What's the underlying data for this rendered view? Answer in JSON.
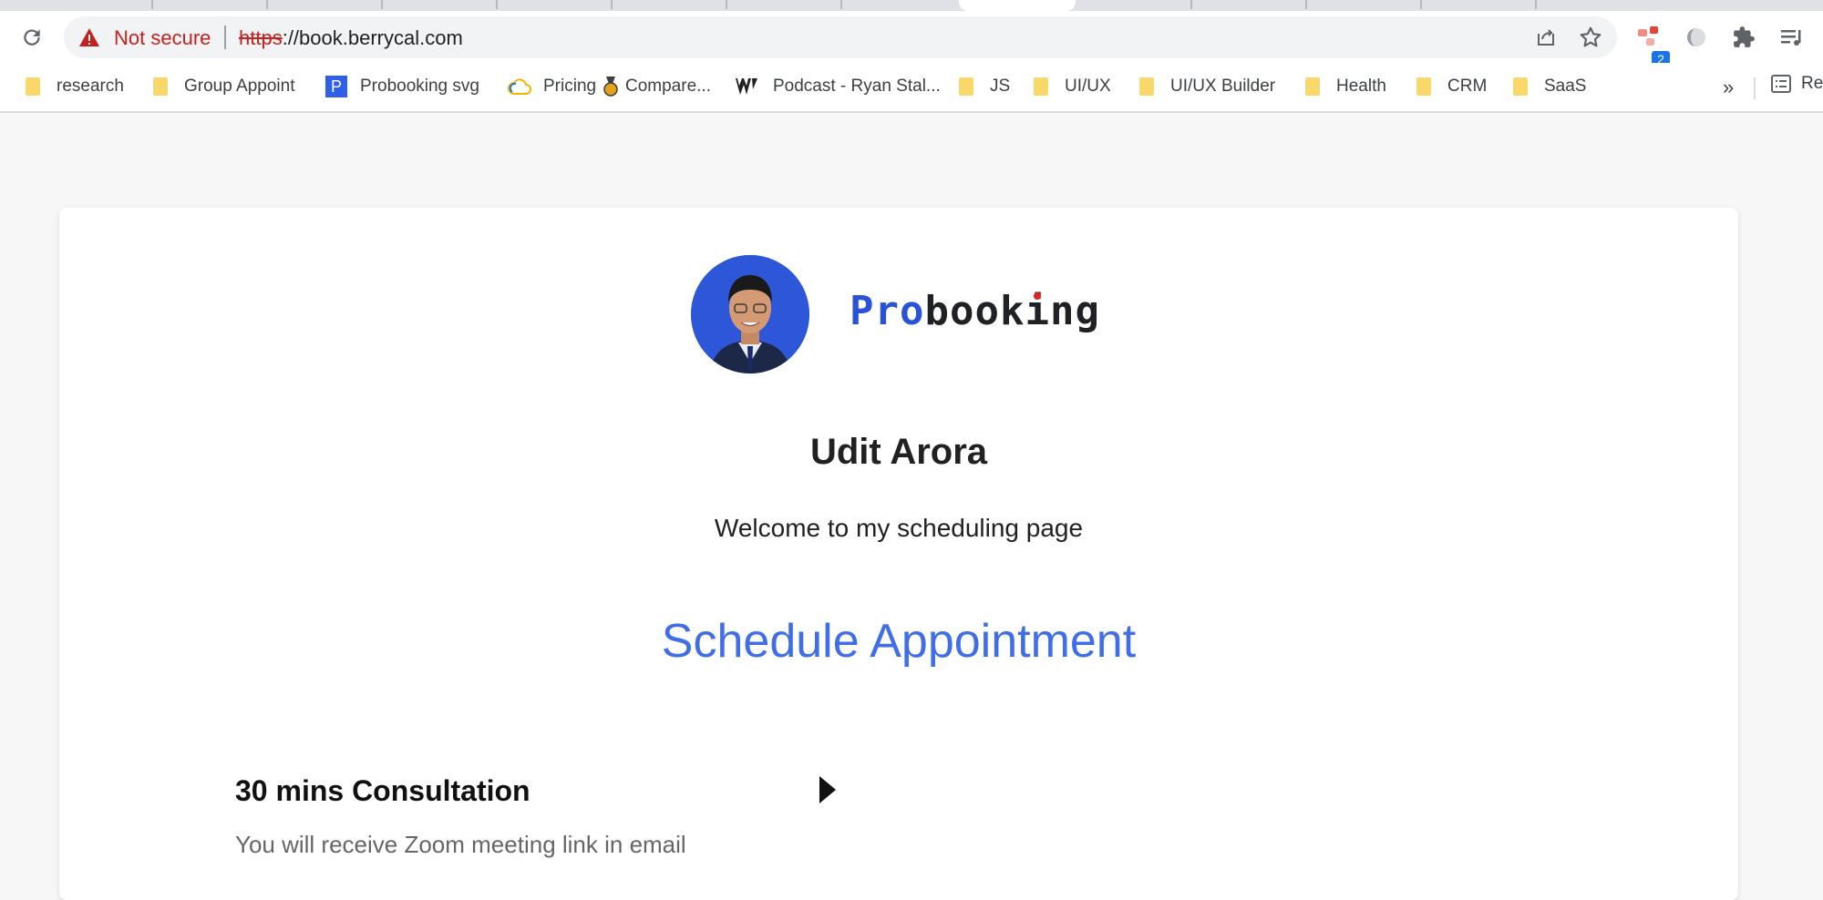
{
  "browser": {
    "address_bar": {
      "security_label": "Not secure",
      "url_scheme": "https",
      "url_rest": "://book.berrycal.com"
    },
    "extension_badge": "2",
    "bookmarks": [
      {
        "label": "research",
        "icon": "folder-icon"
      },
      {
        "label": "Group Appoint",
        "icon": "folder-icon"
      },
      {
        "label": "Probooking svg",
        "icon": "probooking-favicon",
        "favicon_letter": "P"
      },
      {
        "label": "Pricing",
        "icon": "cloud-favicon"
      },
      {
        "label": "Compare...",
        "icon": "medal-favicon"
      },
      {
        "label": "Podcast - Ryan Stal...",
        "icon": "podcast-favicon"
      },
      {
        "label": "JS",
        "icon": "folder-icon"
      },
      {
        "label": "UI/UX",
        "icon": "folder-icon"
      },
      {
        "label": "UI/UX Builder",
        "icon": "folder-icon"
      },
      {
        "label": "Health",
        "icon": "folder-icon"
      },
      {
        "label": "CRM",
        "icon": "folder-icon"
      },
      {
        "label": "SaaS",
        "icon": "folder-icon"
      }
    ],
    "bookmarks_more": "»",
    "reading_list_label": "Re"
  },
  "page": {
    "brand": {
      "part1": "Pro",
      "part2": "book",
      "part3": "i",
      "part4": "ng"
    },
    "profile_name": "Udit Arora",
    "welcome_text": "Welcome to my scheduling page",
    "section_title": "Schedule Appointment",
    "event": {
      "title": "30 mins Consultation",
      "description": "You will receive Zoom meeting link in email"
    }
  },
  "colors": {
    "accent": "#3f6ee8",
    "brand_blue": "#2952d6",
    "warning_red": "#c5221f",
    "page_bg": "#f7f7f7"
  }
}
